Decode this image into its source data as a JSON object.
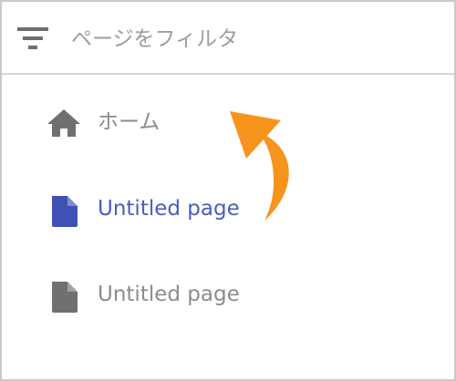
{
  "filter": {
    "placeholder": "ページをフィルタ",
    "value": "",
    "icon": "filter-icon"
  },
  "nav": {
    "items": [
      {
        "label": "ホーム",
        "icon": "home-icon",
        "active": false
      },
      {
        "label": "Untitled page",
        "icon": "page-icon",
        "active": true
      },
      {
        "label": "Untitled page",
        "icon": "page-icon",
        "active": false
      }
    ]
  },
  "annotation": {
    "icon": "curved-arrow-icon"
  },
  "colors": {
    "active": "#4a5dbf",
    "muted": "#8c8c8c",
    "icon_muted": "#707070",
    "arrow": "#f7941d",
    "divider": "#d6d6d6"
  }
}
